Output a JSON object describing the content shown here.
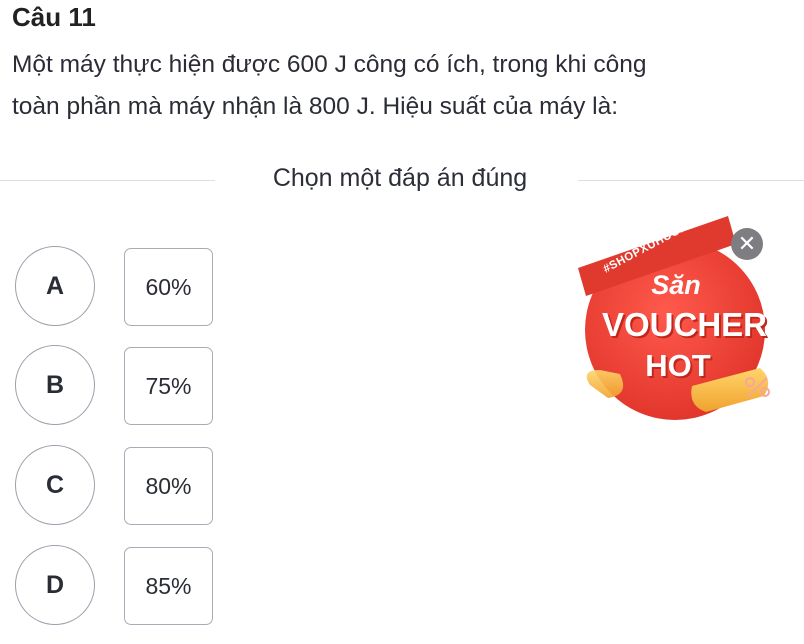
{
  "question": {
    "number": "Câu 11",
    "line1": "Một máy thực hiện được 600 J công có ích, trong khi công",
    "line2": "toàn phần mà máy nhận là 800 J. Hiệu suất của máy là:"
  },
  "instruction": "Chọn một đáp án đúng",
  "options": [
    {
      "letter": "A",
      "text": "60%"
    },
    {
      "letter": "B",
      "text": "75%"
    },
    {
      "letter": "C",
      "text": "80%"
    },
    {
      "letter": "D",
      "text": "85%"
    }
  ],
  "promo": {
    "hashtag": "#SHOPXUHUONG",
    "title": "Săn",
    "voucher": "VOUCHER",
    "hot": "HOT",
    "close_icon": "close-icon",
    "colors": {
      "badge": "#f2433a",
      "banner": "#e03a2e",
      "coin": "#f6b93b"
    }
  }
}
